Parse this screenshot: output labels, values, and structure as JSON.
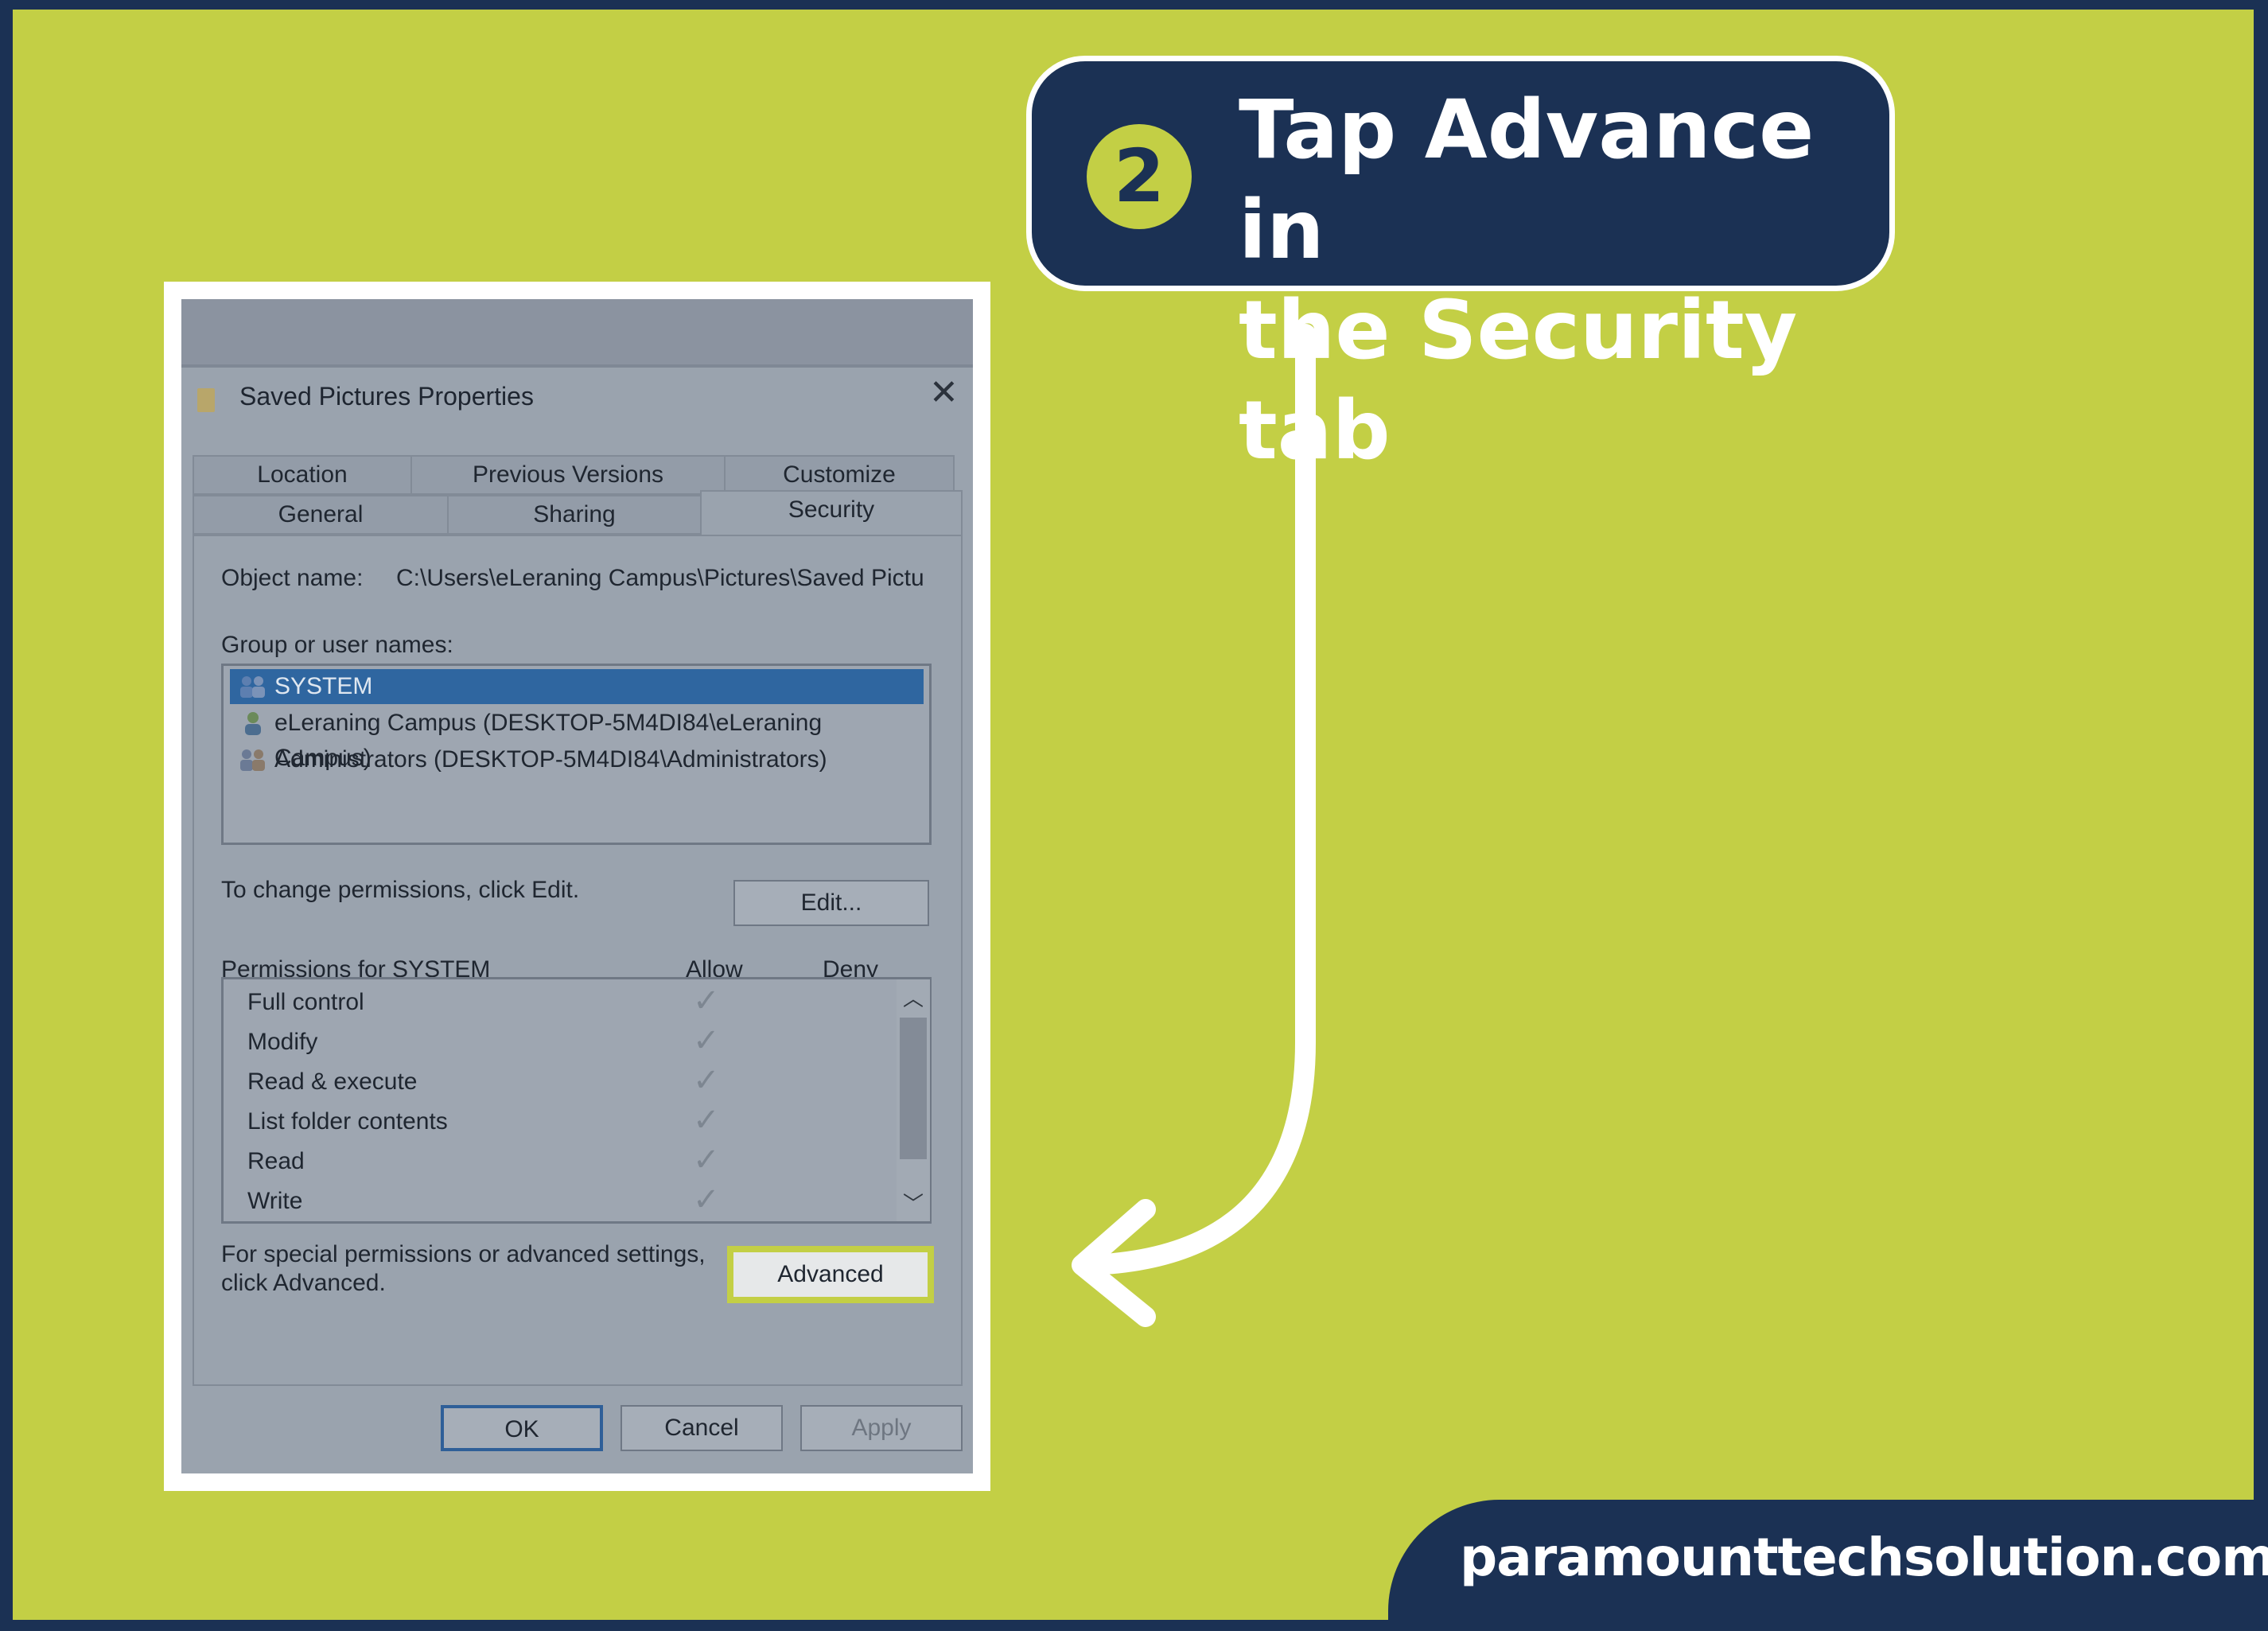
{
  "callout": {
    "step_number": "2",
    "text": "Tap Advance in\nthe Security tab"
  },
  "footer": {
    "site": "paramounttechsolution.com"
  },
  "dialog": {
    "title": "Saved Pictures Properties",
    "tabs_row1": [
      "Location",
      "Previous Versions",
      "Customize"
    ],
    "tabs_row2": [
      "General",
      "Sharing",
      "Security"
    ],
    "active_tab": "Security",
    "object_name_label": "Object name:",
    "object_name_value": "C:\\Users\\eLeraning Campus\\Pictures\\Saved Pictu",
    "group_label": "Group or user names:",
    "users": [
      {
        "name": "SYSTEM",
        "selected": true
      },
      {
        "name": "eLeraning Campus (DESKTOP-5M4DI84\\eLeraning Campus)",
        "selected": false
      },
      {
        "name": "Administrators (DESKTOP-5M4DI84\\Administrators)",
        "selected": false
      }
    ],
    "change_hint": "To change permissions, click Edit.",
    "edit_button": "Edit...",
    "permissions_label": "Permissions for SYSTEM",
    "allow_header": "Allow",
    "deny_header": "Deny",
    "permissions": [
      {
        "name": "Full control",
        "allow": true
      },
      {
        "name": "Modify",
        "allow": true
      },
      {
        "name": "Read & execute",
        "allow": true
      },
      {
        "name": "List folder contents",
        "allow": true
      },
      {
        "name": "Read",
        "allow": true
      },
      {
        "name": "Write",
        "allow": true
      }
    ],
    "special_hint_line1": "For special permissions or advanced settings,",
    "special_hint_line2": "click Advanced.",
    "advanced_button": "Advanced",
    "ok_button": "OK",
    "cancel_button": "Cancel",
    "apply_button": "Apply"
  },
  "colors": {
    "background": "#c3cf45",
    "navy": "#1b3154",
    "selection": "#2f66a0"
  }
}
